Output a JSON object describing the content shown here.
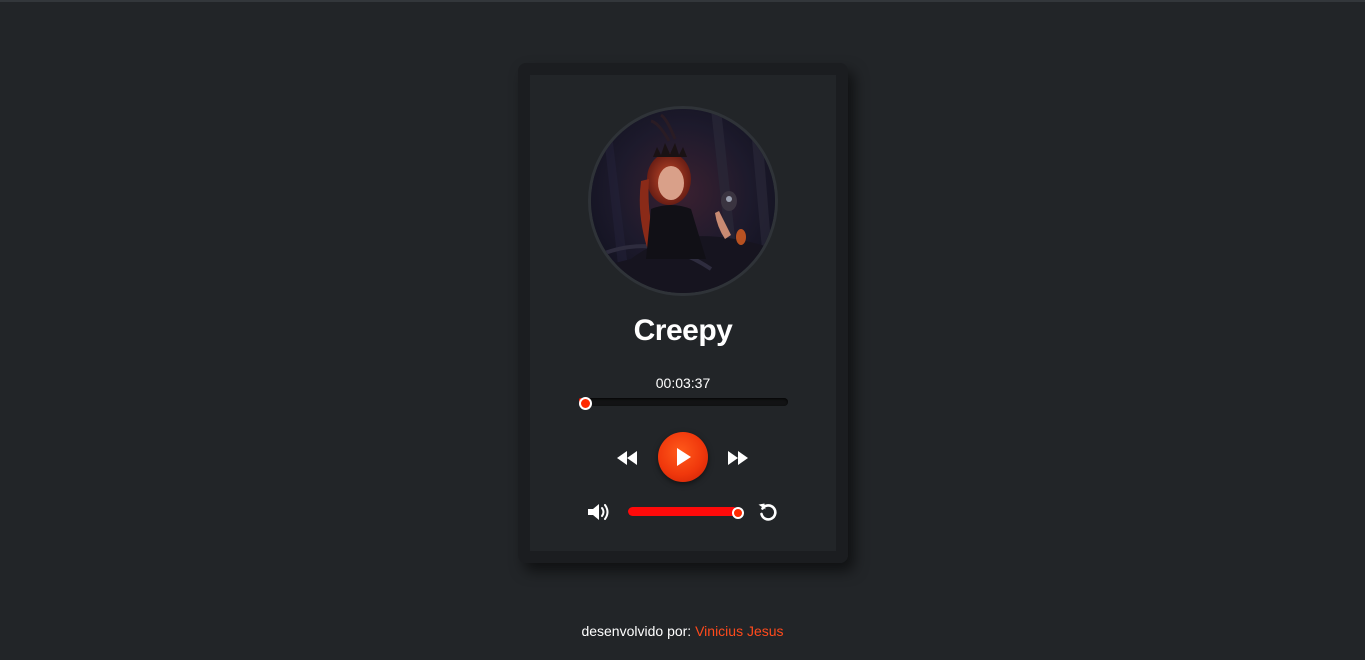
{
  "player": {
    "track_title": "Creepy",
    "current_time": "00:03:37",
    "progress_fraction": 0.02,
    "volume_fraction": 1.0,
    "cover_image": "album-cover",
    "icons": {
      "rewind": "rewind-icon",
      "play": "play-icon",
      "forward": "fast-forward-icon",
      "volume": "volume-icon",
      "restart": "restart-icon"
    }
  },
  "footer": {
    "prefix": "desenvolvido por:",
    "author": "Vinicius Jesus"
  },
  "colors": {
    "background": "#222528",
    "accent": "#ff4a1c",
    "volume_bar": "#ff0a0a"
  }
}
